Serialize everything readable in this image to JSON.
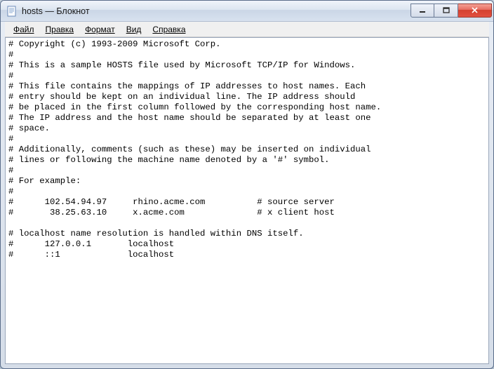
{
  "window": {
    "title": "hosts — Блокнот"
  },
  "menu": {
    "file": "Файл",
    "edit": "Правка",
    "format": "Формат",
    "view": "Вид",
    "help": "Справка"
  },
  "buttons": {
    "minimize": "–",
    "maximize": "▢",
    "close": "✕"
  },
  "content": "# Copyright (c) 1993-2009 Microsoft Corp.\n#\n# This is a sample HOSTS file used by Microsoft TCP/IP for Windows.\n#\n# This file contains the mappings of IP addresses to host names. Each\n# entry should be kept on an individual line. The IP address should\n# be placed in the first column followed by the corresponding host name.\n# The IP address and the host name should be separated by at least one\n# space.\n#\n# Additionally, comments (such as these) may be inserted on individual\n# lines or following the machine name denoted by a '#' symbol.\n#\n# For example:\n#\n#      102.54.94.97     rhino.acme.com          # source server\n#       38.25.63.10     x.acme.com              # x client host\n\n# localhost name resolution is handled within DNS itself.\n#      127.0.0.1       localhost\n#      ::1             localhost"
}
